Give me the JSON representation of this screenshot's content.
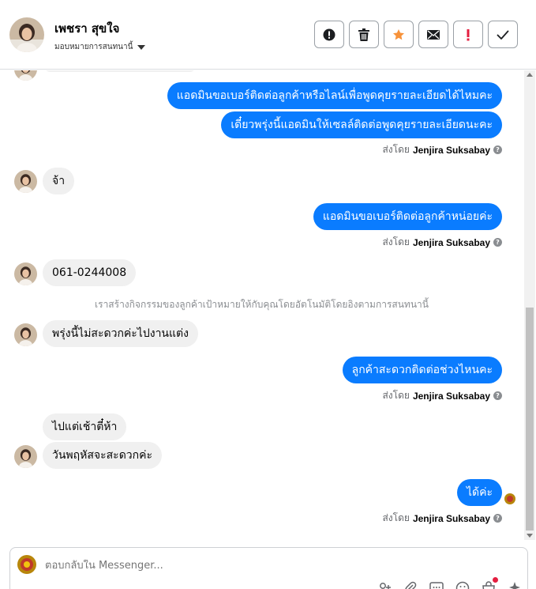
{
  "header": {
    "contact_name": "เพชรา สุขใจ",
    "assign_label": "มอบหมายการสนทนานี้"
  },
  "actions": [
    {
      "name": "report-icon",
      "tip": "!"
    },
    {
      "name": "trash-icon"
    },
    {
      "name": "star-icon"
    },
    {
      "name": "mail-icon"
    },
    {
      "name": "exclamation-icon"
    },
    {
      "name": "check-icon"
    }
  ],
  "messages": {
    "m1": "แอดมินขอเบอร์ติดต่อลูกค้าหรือไลน์เพื่อพูดคุยรายละเอียดได้ไหมคะ",
    "m2": "เดี๋ยวพรุ่งนี้แอดมินให้เซลล์ติดต่อพูดคุยรายละเอียดนะคะ",
    "m3": "จ้า",
    "m4": "แอดมินขอเบอร์ติดต่อลูกค้าหน่อยค่ะ",
    "m5": "061-0244008",
    "m6": "พรุ่งนี้ไม่สะดวกค่ะไปงานแต่ง",
    "m7": "ลูกค้าสะดวกติดต่อช่วงไหนคะ",
    "m8": "ไปแต่เช้าตี๋ห้า",
    "m9": "วันพฤหัสจะสะดวกค่ะ",
    "m10": "ได้ค่ะ"
  },
  "sent_by": {
    "prefix": "ส่งโดย",
    "agent": "Jenjira Suksabay"
  },
  "system_note": "เราสร้างกิจกรรมของลูกค้าเป้าหมายให้กับคุณโดยอัตโนมัติโดยอิงตามการสนทนานี้",
  "composer": {
    "placeholder": "ตอบกลับใน Messenger..."
  },
  "colors": {
    "outgoing_bubble": "#0a7cff",
    "incoming_bubble": "#f0f0f0",
    "star": "#f7923a",
    "exclamation": "#e41e3f"
  }
}
